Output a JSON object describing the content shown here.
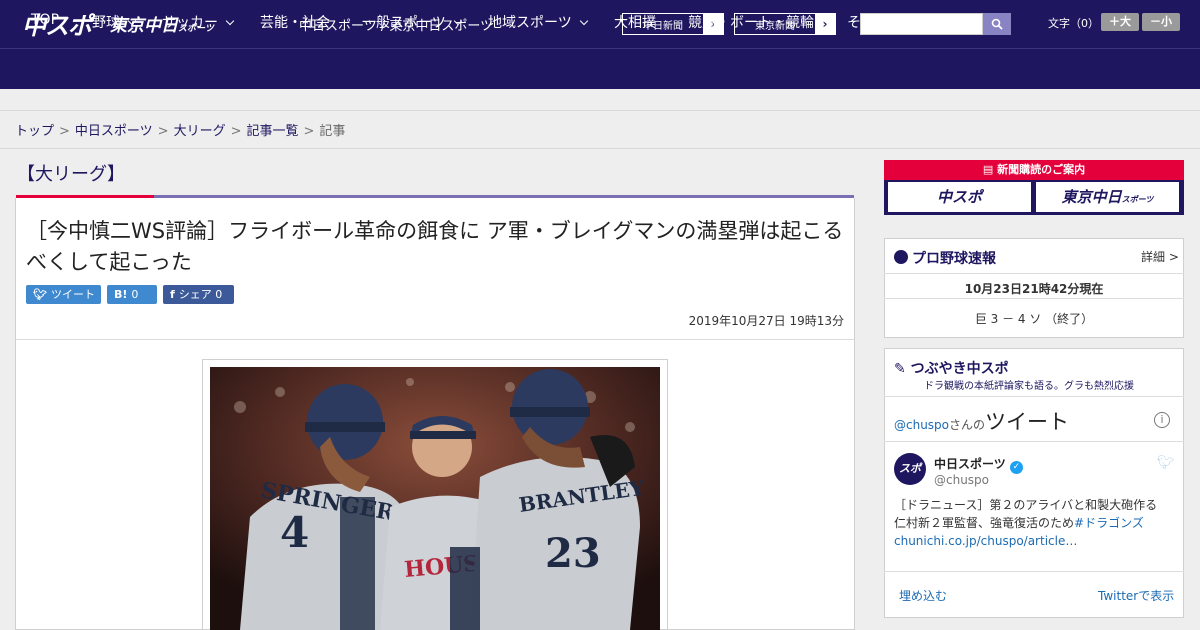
{
  "header": {
    "logo_main": "中スポ",
    "logo_tokyo": "東京中日",
    "logo_tokyo_small": "スポーツ",
    "site_name": "中日スポーツ / 東京中日スポーツ",
    "link1": "中日新聞",
    "link2": "東京新聞",
    "font_label": "文字（0）",
    "font_plus": "＋大",
    "font_minus": "－小"
  },
  "nav": {
    "items": [
      {
        "label": "TOP",
        "dropdown": false
      },
      {
        "label": "野球",
        "dropdown": true
      },
      {
        "label": "サッカー",
        "dropdown": true
      },
      {
        "label": "芸能・社会",
        "dropdown": false
      },
      {
        "label": "一般スポーツ",
        "dropdown": true
      },
      {
        "label": "地域スポーツ",
        "dropdown": true
      },
      {
        "label": "大相撲",
        "dropdown": false
      },
      {
        "label": "競馬・ボート・競輪",
        "dropdown": false
      },
      {
        "label": "その他",
        "dropdown": true
      }
    ]
  },
  "breadcrumb": [
    "トップ",
    "中日スポーツ",
    "大リーグ",
    "記事一覧",
    "記事"
  ],
  "article": {
    "category": "【大リーグ】",
    "headline": "［今中慎二WS評論］フライボール革命の餌食に ア軍・ブレイグマンの満塁弾は起こるべくして起こった",
    "tweet_label": "ツイート",
    "hatena_label": "B!",
    "hatena_count": "0",
    "share_label": "シェア",
    "share_count": "0",
    "date": "2019年10月27日 19時13分",
    "photo_jerseys": [
      "SPRINGER",
      "4",
      "HOUSTON",
      "BRANTLEY",
      "23"
    ]
  },
  "sidebar": {
    "subscription_title": "新聞購読のご案内",
    "sub_logo1": "中スポ",
    "sub_logo2": "東京中日",
    "sub_logo2_small": "スポーツ",
    "scores": {
      "title": "プロ野球速報",
      "detail_link": "詳細 >",
      "timestamp": "10月23日21時42分現在",
      "result": "巨 3 － 4 ソ （終了）"
    },
    "twitter": {
      "title": "つぶやき中スポ",
      "subtitle": "ドラ観戦の本紙評論家も語る。グラも熱烈応援",
      "handle_prefix": "@chuspo",
      "handle_suffix": "さんの",
      "tweets_label": "ツイート",
      "account_name": "中日スポーツ",
      "account_handle": "@chuspo",
      "tweet_text": "［ドラニュース］第２のアライバと和製大砲作る仁村新２軍監督、強竜復活のため",
      "tweet_hashtag": "#ドラゴンズ",
      "tweet_link": "chunichi.co.jp/chuspo/article…",
      "embed_label": "埋め込む",
      "view_label": "Twitterで表示"
    }
  },
  "colors": {
    "brand": "#1e1760",
    "accent_red": "#e4003a",
    "twitter_blue": "#3e89cf",
    "facebook_blue": "#3c5a99"
  }
}
